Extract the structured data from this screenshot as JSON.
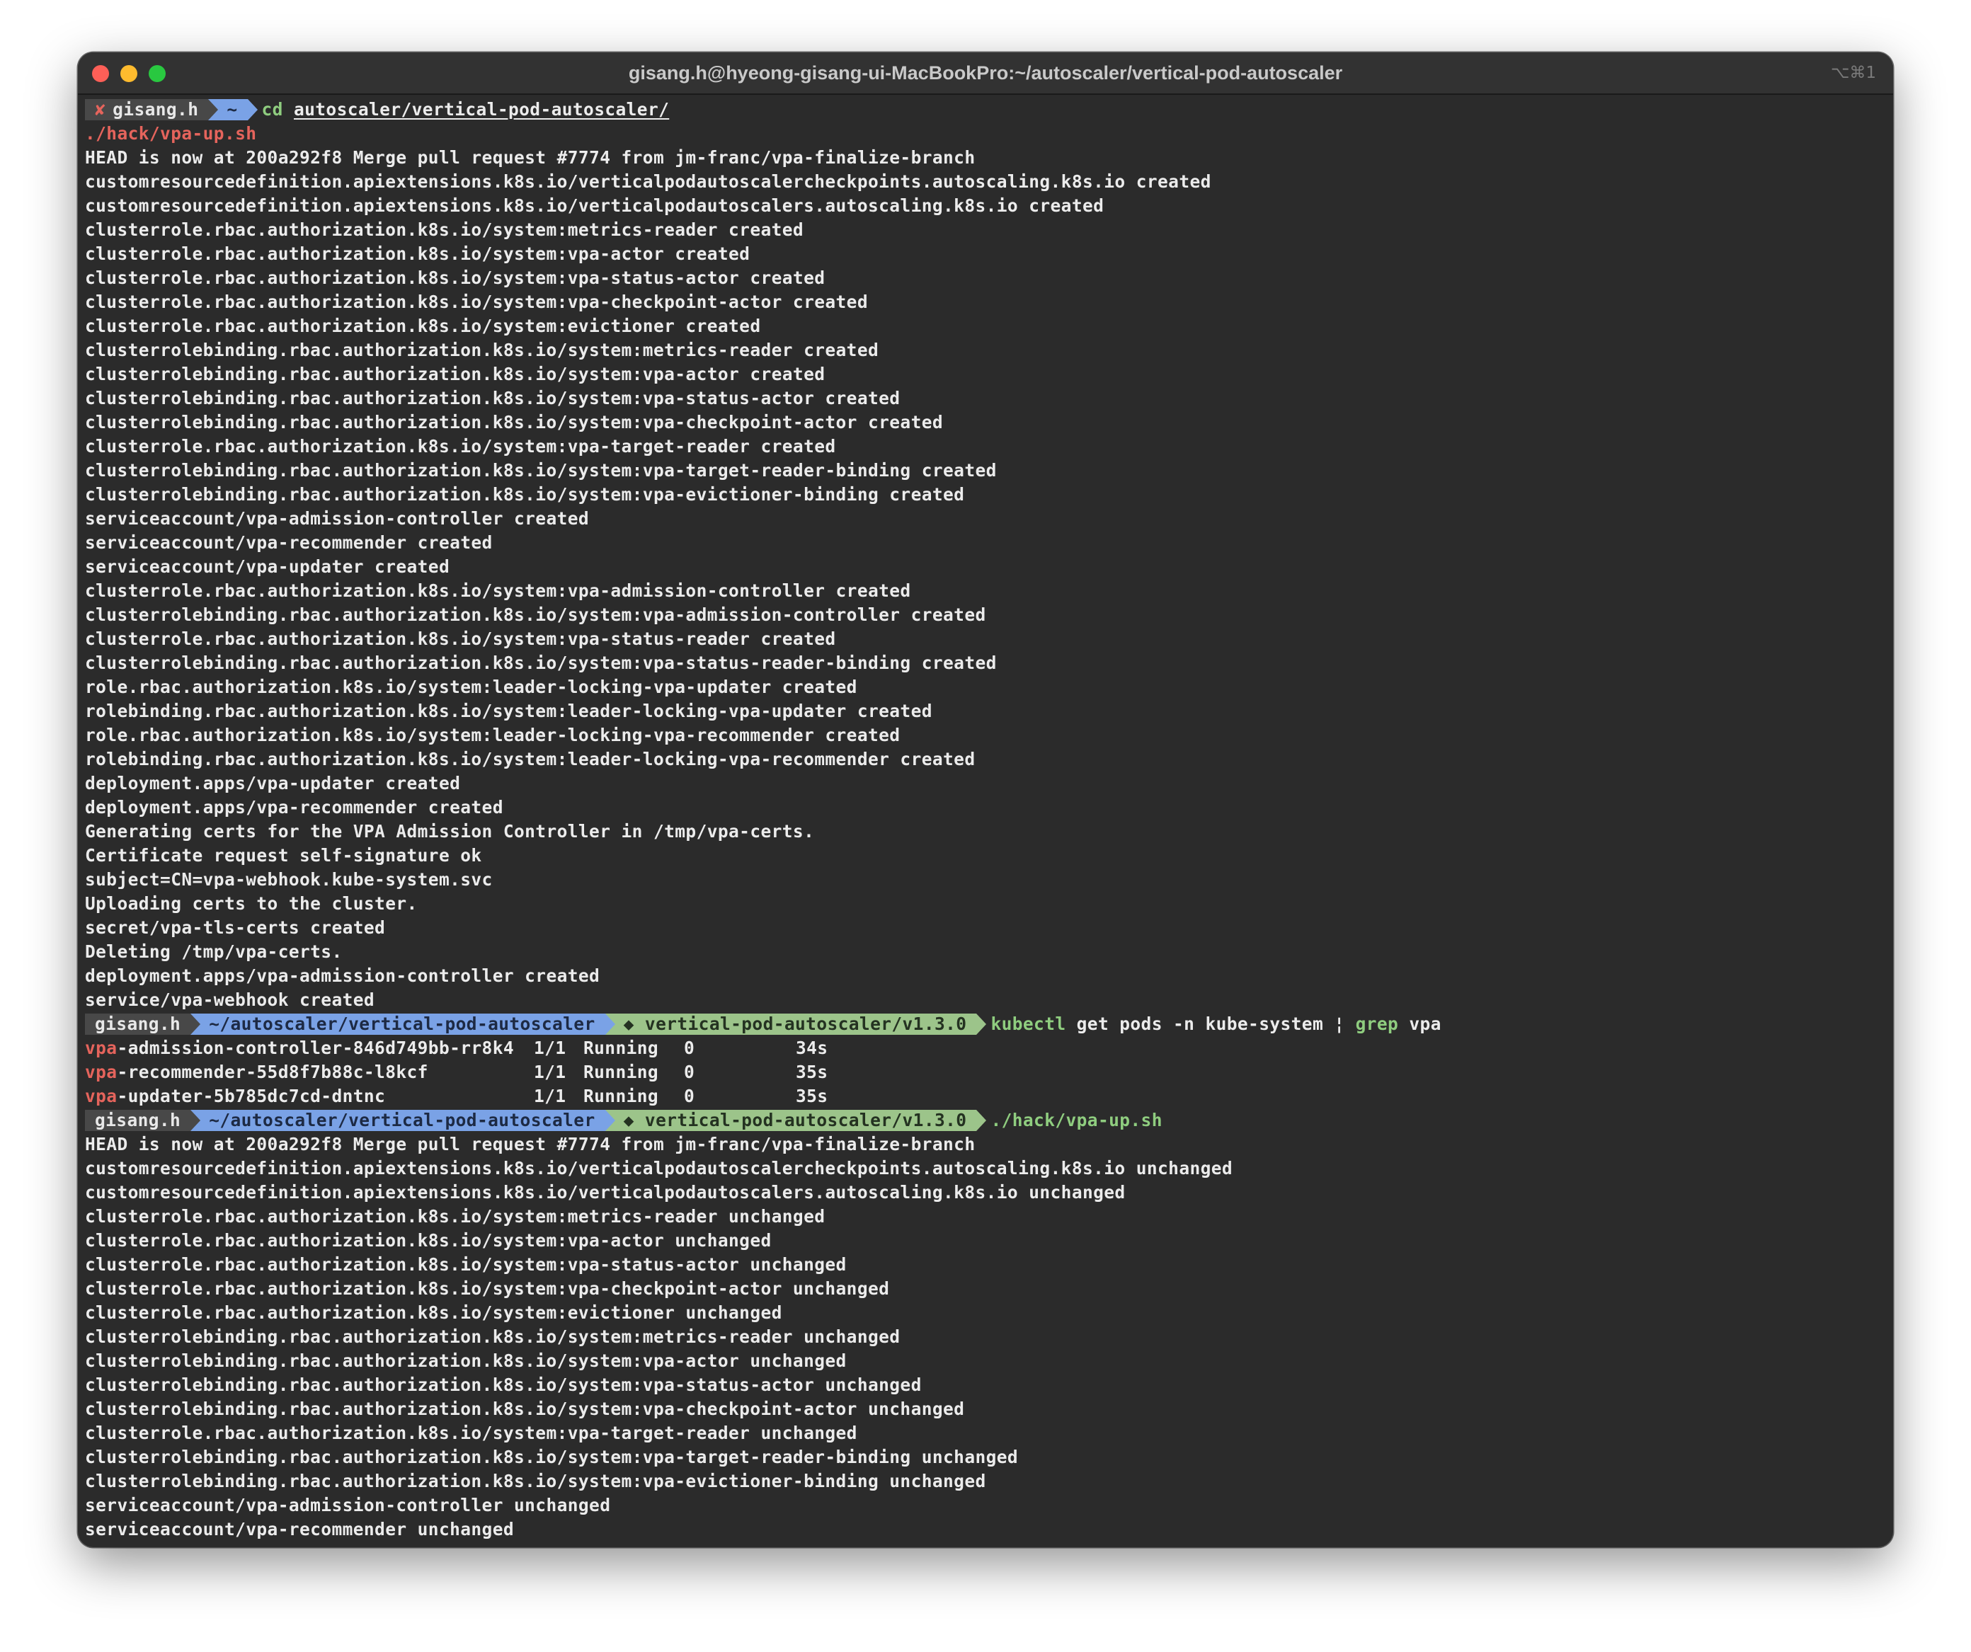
{
  "window": {
    "title": "gisang.h@hyeong-gisang-ui-MacBookPro:~/autoscaler/vertical-pod-autoscaler",
    "tab_shortcut": "⌥⌘1"
  },
  "prompt1": {
    "status_icon": "✘",
    "user": "gisang.h",
    "dir": "~",
    "command": "cd",
    "argument": "autoscaler/vertical-pod-autoscaler/"
  },
  "autosuggest": "./hack/vpa-up.sh",
  "output1": [
    "HEAD is now at 200a292f8 Merge pull request #7774 from jm-franc/vpa-finalize-branch",
    "customresourcedefinition.apiextensions.k8s.io/verticalpodautoscalercheckpoints.autoscaling.k8s.io created",
    "customresourcedefinition.apiextensions.k8s.io/verticalpodautoscalers.autoscaling.k8s.io created",
    "clusterrole.rbac.authorization.k8s.io/system:metrics-reader created",
    "clusterrole.rbac.authorization.k8s.io/system:vpa-actor created",
    "clusterrole.rbac.authorization.k8s.io/system:vpa-status-actor created",
    "clusterrole.rbac.authorization.k8s.io/system:vpa-checkpoint-actor created",
    "clusterrole.rbac.authorization.k8s.io/system:evictioner created",
    "clusterrolebinding.rbac.authorization.k8s.io/system:metrics-reader created",
    "clusterrolebinding.rbac.authorization.k8s.io/system:vpa-actor created",
    "clusterrolebinding.rbac.authorization.k8s.io/system:vpa-status-actor created",
    "clusterrolebinding.rbac.authorization.k8s.io/system:vpa-checkpoint-actor created",
    "clusterrole.rbac.authorization.k8s.io/system:vpa-target-reader created",
    "clusterrolebinding.rbac.authorization.k8s.io/system:vpa-target-reader-binding created",
    "clusterrolebinding.rbac.authorization.k8s.io/system:vpa-evictioner-binding created",
    "serviceaccount/vpa-admission-controller created",
    "serviceaccount/vpa-recommender created",
    "serviceaccount/vpa-updater created",
    "clusterrole.rbac.authorization.k8s.io/system:vpa-admission-controller created",
    "clusterrolebinding.rbac.authorization.k8s.io/system:vpa-admission-controller created",
    "clusterrole.rbac.authorization.k8s.io/system:vpa-status-reader created",
    "clusterrolebinding.rbac.authorization.k8s.io/system:vpa-status-reader-binding created",
    "role.rbac.authorization.k8s.io/system:leader-locking-vpa-updater created",
    "rolebinding.rbac.authorization.k8s.io/system:leader-locking-vpa-updater created",
    "role.rbac.authorization.k8s.io/system:leader-locking-vpa-recommender created",
    "rolebinding.rbac.authorization.k8s.io/system:leader-locking-vpa-recommender created",
    "deployment.apps/vpa-updater created",
    "deployment.apps/vpa-recommender created",
    "Generating certs for the VPA Admission Controller in /tmp/vpa-certs.",
    "Certificate request self-signature ok",
    "subject=CN=vpa-webhook.kube-system.svc",
    "Uploading certs to the cluster.",
    "secret/vpa-tls-certs created",
    "Deleting /tmp/vpa-certs.",
    "deployment.apps/vpa-admission-controller created",
    "service/vpa-webhook created"
  ],
  "prompt2": {
    "user": "gisang.h",
    "dir": "~/autoscaler/vertical-pod-autoscaler",
    "git": "◆ vertical-pod-autoscaler/v1.3.0",
    "command": "kubectl",
    "args": "get pods -n kube-system",
    "pipe": "¦",
    "grep": "grep",
    "grep_arg": "vpa"
  },
  "pods": [
    {
      "prefix": "vpa",
      "name": "-admission-controller-846d749bb-rr8k4",
      "ready": "1/1",
      "status": "Running",
      "restarts": "0",
      "age": "34s"
    },
    {
      "prefix": "vpa",
      "name": "-recommender-55d8f7b88c-l8kcf",
      "ready": "1/1",
      "status": "Running",
      "restarts": "0",
      "age": "35s"
    },
    {
      "prefix": "vpa",
      "name": "-updater-5b785dc7cd-dntnc",
      "ready": "1/1",
      "status": "Running",
      "restarts": "0",
      "age": "35s"
    }
  ],
  "prompt3": {
    "user": "gisang.h",
    "dir": "~/autoscaler/vertical-pod-autoscaler",
    "git": "◆ vertical-pod-autoscaler/v1.3.0",
    "command": "./hack/vpa-up.sh"
  },
  "output2": [
    "HEAD is now at 200a292f8 Merge pull request #7774 from jm-franc/vpa-finalize-branch",
    "customresourcedefinition.apiextensions.k8s.io/verticalpodautoscalercheckpoints.autoscaling.k8s.io unchanged",
    "customresourcedefinition.apiextensions.k8s.io/verticalpodautoscalers.autoscaling.k8s.io unchanged",
    "clusterrole.rbac.authorization.k8s.io/system:metrics-reader unchanged",
    "clusterrole.rbac.authorization.k8s.io/system:vpa-actor unchanged",
    "clusterrole.rbac.authorization.k8s.io/system:vpa-status-actor unchanged",
    "clusterrole.rbac.authorization.k8s.io/system:vpa-checkpoint-actor unchanged",
    "clusterrole.rbac.authorization.k8s.io/system:evictioner unchanged",
    "clusterrolebinding.rbac.authorization.k8s.io/system:metrics-reader unchanged",
    "clusterrolebinding.rbac.authorization.k8s.io/system:vpa-actor unchanged",
    "clusterrolebinding.rbac.authorization.k8s.io/system:vpa-status-actor unchanged",
    "clusterrolebinding.rbac.authorization.k8s.io/system:vpa-checkpoint-actor unchanged",
    "clusterrole.rbac.authorization.k8s.io/system:vpa-target-reader unchanged",
    "clusterrolebinding.rbac.authorization.k8s.io/system:vpa-target-reader-binding unchanged",
    "clusterrolebinding.rbac.authorization.k8s.io/system:vpa-evictioner-binding unchanged",
    "serviceaccount/vpa-admission-controller unchanged",
    "serviceaccount/vpa-recommender unchanged"
  ]
}
